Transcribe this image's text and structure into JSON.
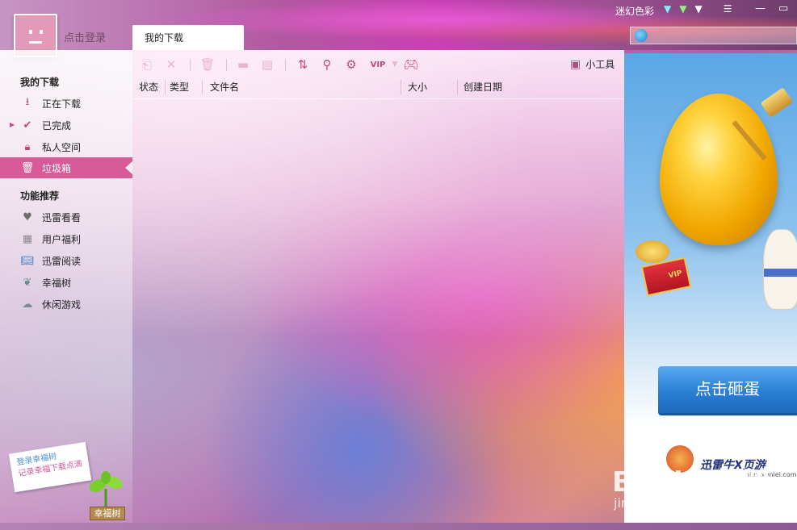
{
  "window": {
    "skin_name": "迷幻色彩",
    "login_text": "点击登录",
    "tab_title": "我的下载",
    "search_placeholder": ""
  },
  "title_icons": [
    "tshirt-cyan-icon",
    "tshirt-green-icon",
    "tshirt-white-icon",
    "menu-icon",
    "minimize-icon",
    "maximize-icon",
    "close-icon"
  ],
  "sidebar": {
    "section1_title": "我的下载",
    "items": [
      {
        "label": "正在下载",
        "icon": "download-icon"
      },
      {
        "label": "已完成",
        "icon": "check-icon"
      },
      {
        "label": "私人空间",
        "icon": "lock-icon"
      },
      {
        "label": "垃圾箱",
        "icon": "trash-icon",
        "active": true
      }
    ],
    "section2_title": "功能推荐",
    "features": [
      {
        "label": "迅雷看看",
        "icon": "xunlei-kankan-icon"
      },
      {
        "label": "用户福利",
        "icon": "gift-icon"
      },
      {
        "label": "迅雷阅读",
        "icon": "book-icon"
      },
      {
        "label": "幸福树",
        "icon": "tree-icon"
      },
      {
        "label": "休闲游戏",
        "icon": "game-icon"
      }
    ],
    "lucky_note_line1": "登录幸福树",
    "lucky_note_line2": "记录幸福下载点滴",
    "lucky_tree_label": "幸福树"
  },
  "toolbar": {
    "buttons": [
      "restore-icon",
      "delete-icon",
      "trash-icon",
      "folder-icon",
      "file-icon",
      "sort-icon",
      "search-icon",
      "settings-icon",
      "vip-icon",
      "gamepad-icon"
    ],
    "tools_label": "小工具"
  },
  "columns": [
    "状态",
    "类型",
    "文件名",
    "大小",
    "创建日期"
  ],
  "ad": {
    "button_label": "点击砸蛋",
    "vip_text": "VIP",
    "logo_text": "迅雷牛X页游",
    "url_text": "niux.xunlei.com"
  },
  "watermark": {
    "text": "Baidu 经验",
    "url": "jingyan.baidu.com"
  }
}
